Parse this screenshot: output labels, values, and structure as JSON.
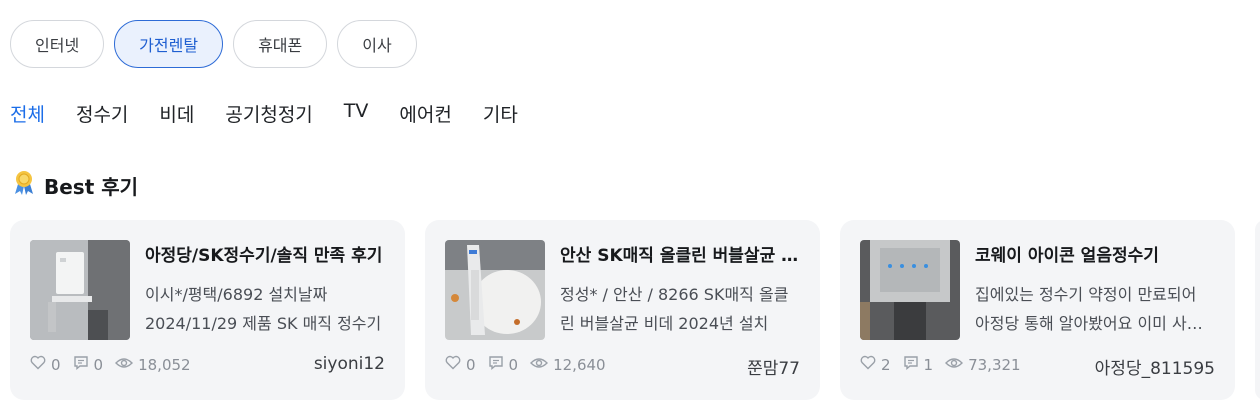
{
  "categories": [
    {
      "label": "인터넷",
      "active": false
    },
    {
      "label": "가전렌탈",
      "active": true
    },
    {
      "label": "휴대폰",
      "active": false
    },
    {
      "label": "이사",
      "active": false
    }
  ],
  "subtabs": [
    {
      "label": "전체",
      "active": true
    },
    {
      "label": "정수기",
      "active": false
    },
    {
      "label": "비데",
      "active": false
    },
    {
      "label": "공기청정기",
      "active": false
    },
    {
      "label": "TV",
      "active": false
    },
    {
      "label": "에어컨",
      "active": false
    },
    {
      "label": "기타",
      "active": false
    }
  ],
  "best": {
    "icon": "award-ribbon-icon",
    "title": "Best 후기"
  },
  "reviews": [
    {
      "title": "아정당/SK정수기/솔직 만족 후기",
      "description": "이시*/평택/6892 설치날짜 2024/11/29 제품 SK 매직 정수기",
      "likes": "0",
      "comments": "0",
      "views": "18,052",
      "author": "siyoni12"
    },
    {
      "title": "안산 SK매직 올클린 버블살균 비데",
      "description": "정성* / 안산 / 8266 SK매직 올클린 버블살균 비데 2024년 설치",
      "likes": "0",
      "comments": "0",
      "views": "12,640",
      "author": "쭌맘77"
    },
    {
      "title": "코웨이 아이콘 얼음정수기",
      "description": "집에있는 정수기 약정이 만료되어 아정당 통해 알아봤어요 이미 사용중",
      "likes": "2",
      "comments": "1",
      "views": "73,321",
      "author": "아정당_811595"
    }
  ],
  "colors": {
    "accent": "#1c6ee8",
    "chip_active_bg": "#eaf1fd",
    "card_bg": "#f4f5f7"
  }
}
